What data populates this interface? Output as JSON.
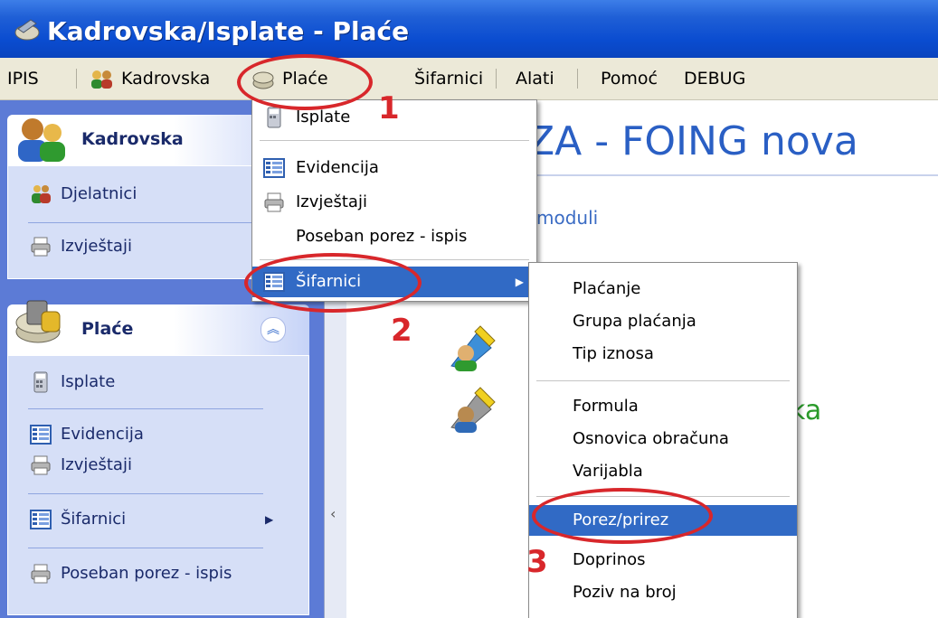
{
  "window": {
    "title": "Kadrovska/Isplate - Plaće"
  },
  "menubar": {
    "items": [
      {
        "label": "IPIS"
      },
      {
        "label": "Kadrovska"
      },
      {
        "label": "Plaće"
      },
      {
        "label": "Šifarnici"
      },
      {
        "label": "Alati"
      },
      {
        "label": "Pomoć"
      },
      {
        "label": "DEBUG"
      }
    ]
  },
  "sidebar": {
    "kadrovska": {
      "header": "Kadrovska",
      "items": [
        {
          "label": "Djelatnici"
        },
        {
          "label": "Izvještaji"
        }
      ]
    },
    "place": {
      "header": "Plaće",
      "items": [
        {
          "label": "Isplate"
        },
        {
          "label": "Evidencija"
        },
        {
          "label": "Izvještaji"
        },
        {
          "label": "Šifarnici"
        },
        {
          "label": "Poseban porez - ispis"
        }
      ]
    }
  },
  "main": {
    "title_fragment": "ZA - FOING nova",
    "moduli_fragment": "moduli",
    "ka_fragment": "ka"
  },
  "place_menu": {
    "items": [
      {
        "label": "Isplate"
      },
      {
        "label": "Evidencija"
      },
      {
        "label": "Izvještaji"
      },
      {
        "label": "Poseban porez - ispis"
      },
      {
        "label": "Šifarnici"
      }
    ]
  },
  "sifarnici_submenu": {
    "items": [
      {
        "label": "Plaćanje"
      },
      {
        "label": "Grupa plaćanja"
      },
      {
        "label": "Tip iznosa"
      },
      {
        "label": "Formula"
      },
      {
        "label": "Osnovica obračuna"
      },
      {
        "label": "Varijabla"
      },
      {
        "label": "Porez/prirez"
      },
      {
        "label": "Doprinos"
      },
      {
        "label": "Poziv na broj"
      }
    ]
  },
  "annotations": {
    "step1": "1",
    "step2": "2",
    "step3": "3",
    "ring_color": "#d8272b"
  },
  "colors": {
    "title_bar": "#0a4cd0",
    "menu_bar": "#ece9d8",
    "sidebar": "#5c7bd6",
    "highlight": "#316ac5",
    "main_title": "#2a5fc4"
  },
  "icons": [
    "app-icon",
    "users-icon",
    "coins-icon",
    "calculator-icon",
    "list-icon",
    "printer-icon",
    "submenu-arrow-icon",
    "collapse-icon",
    "user-edit-icon"
  ]
}
